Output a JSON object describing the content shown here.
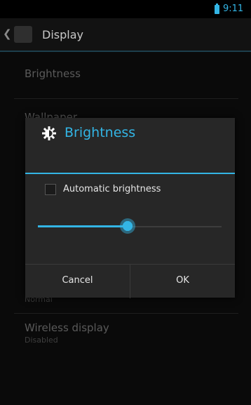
{
  "status_bar": {
    "time": "9:11",
    "battery_icon": "battery-charging-icon"
  },
  "action_bar": {
    "title": "Display",
    "up_icon": "chevron-left-icon",
    "app_icon": "display-settings-icon"
  },
  "preferences": [
    {
      "title": "Brightness",
      "summary": ""
    },
    {
      "title": "Wallpaper",
      "summary": ""
    },
    {
      "title": "",
      "summary": "Normal"
    },
    {
      "title": "Wireless display",
      "summary": "Disabled"
    }
  ],
  "dialog": {
    "title": "Brightness",
    "icon": "brightness-icon",
    "auto_brightness_label": "Automatic brightness",
    "auto_brightness_checked": false,
    "brightness_level": 0.49,
    "cancel_label": "Cancel",
    "ok_label": "OK"
  },
  "colors": {
    "accent": "#33b5e5",
    "background": "#0a0a0a",
    "dialog": "#272727"
  }
}
